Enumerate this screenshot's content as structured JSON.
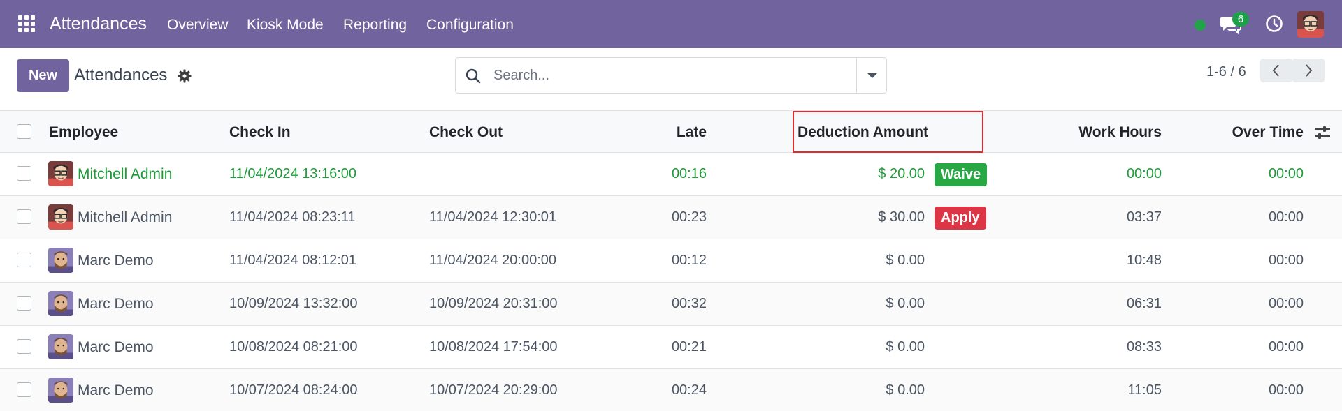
{
  "navbar": {
    "app_title": "Attendances",
    "menu": [
      "Overview",
      "Kiosk Mode",
      "Reporting",
      "Configuration"
    ],
    "message_count": "6",
    "status_color": "#22a34a",
    "bg_color": "#71639e"
  },
  "control_panel": {
    "new_label": "New",
    "title": "Attendances",
    "search_placeholder": "Search...",
    "pager_value": "1-6 / 6"
  },
  "table": {
    "columns": [
      "Employee",
      "Check In",
      "Check Out",
      "Late",
      "Deduction Amount",
      "Work Hours",
      "Over Time"
    ],
    "rows": [
      {
        "employee": "Mitchell Admin",
        "check_in": "11/04/2024 13:16:00",
        "check_out": "",
        "late": "00:16",
        "deduction": "$ 20.00",
        "action": "Waive",
        "work_hours": "00:00",
        "over_time": "00:00",
        "status": "green",
        "avatar": "mitchell"
      },
      {
        "employee": "Mitchell Admin",
        "check_in": "11/04/2024 08:23:11",
        "check_out": "11/04/2024 12:30:01",
        "late": "00:23",
        "deduction": "$ 30.00",
        "action": "Apply",
        "work_hours": "03:37",
        "over_time": "00:00",
        "status": "normal",
        "avatar": "mitchell"
      },
      {
        "employee": "Marc Demo",
        "check_in": "11/04/2024 08:12:01",
        "check_out": "11/04/2024 20:00:00",
        "late": "00:12",
        "deduction": "$ 0.00",
        "action": "",
        "work_hours": "10:48",
        "over_time": "00:00",
        "status": "normal",
        "avatar": "marc"
      },
      {
        "employee": "Marc Demo",
        "check_in": "10/09/2024 13:32:00",
        "check_out": "10/09/2024 20:31:00",
        "late": "00:32",
        "deduction": "$ 0.00",
        "action": "",
        "work_hours": "06:31",
        "over_time": "00:00",
        "status": "normal",
        "avatar": "marc"
      },
      {
        "employee": "Marc Demo",
        "check_in": "10/08/2024 08:21:00",
        "check_out": "10/08/2024 17:54:00",
        "late": "00:21",
        "deduction": "$ 0.00",
        "action": "",
        "work_hours": "08:33",
        "over_time": "00:00",
        "status": "normal",
        "avatar": "marc"
      },
      {
        "employee": "Marc Demo",
        "check_in": "10/07/2024 08:24:00",
        "check_out": "10/07/2024 20:29:00",
        "late": "00:24",
        "deduction": "$ 0.00",
        "action": "",
        "work_hours": "11:05",
        "over_time": "00:00",
        "status": "normal",
        "avatar": "marc"
      }
    ],
    "action_colors": {
      "Waive": "#28a745",
      "Apply": "#dc3545"
    }
  }
}
